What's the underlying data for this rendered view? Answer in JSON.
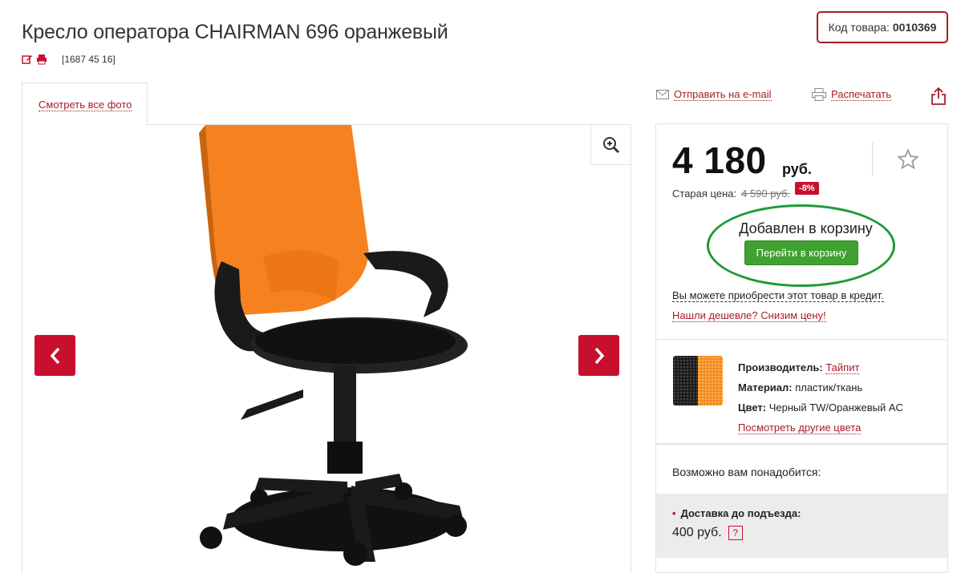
{
  "product": {
    "title": "Кресло оператора CHAIRMAN 696 оранжевый",
    "code_label": "Код товара:",
    "code_value": "0010369",
    "meta_text": "[1687 45   16]"
  },
  "gallery": {
    "tab_label": "Смотреть все фото",
    "prev_icon": "chevron-left-icon",
    "next_icon": "chevron-right-icon",
    "zoom_icon": "zoom-in-icon"
  },
  "actions": {
    "email_label": "Отправить на e-mail",
    "print_label": "Распечатать"
  },
  "price": {
    "value": "4 180",
    "currency": "руб.",
    "old_label": "Старая цена:",
    "old_value": "4 590 руб.",
    "discount": "-8%",
    "added_text": "Добавлен в корзину",
    "cart_button": "Перейти в корзину",
    "credit_text": "Вы можете приобрести этот товар в кредит.",
    "cheaper_text": "Нашли дешевле? Снизим цену!"
  },
  "specs": {
    "manufacturer_label": "Производитель:",
    "manufacturer_value": "Тайпит",
    "material_label": "Материал:",
    "material_value": "пластик/ткань",
    "color_label": "Цвет:",
    "color_value": "Черный TW/Оранжевый AC",
    "other_colors": "Посмотреть другие цвета"
  },
  "need": {
    "title": "Возможно вам понадобится:",
    "delivery_label": "Доставка до подъезда:",
    "delivery_price": "400 руб.",
    "help_mark": "?"
  },
  "colors": {
    "accent": "#a41e23",
    "red_button": "#c8102e",
    "green_button": "#3fa12f",
    "highlight_oval": "#1c9b3a"
  }
}
